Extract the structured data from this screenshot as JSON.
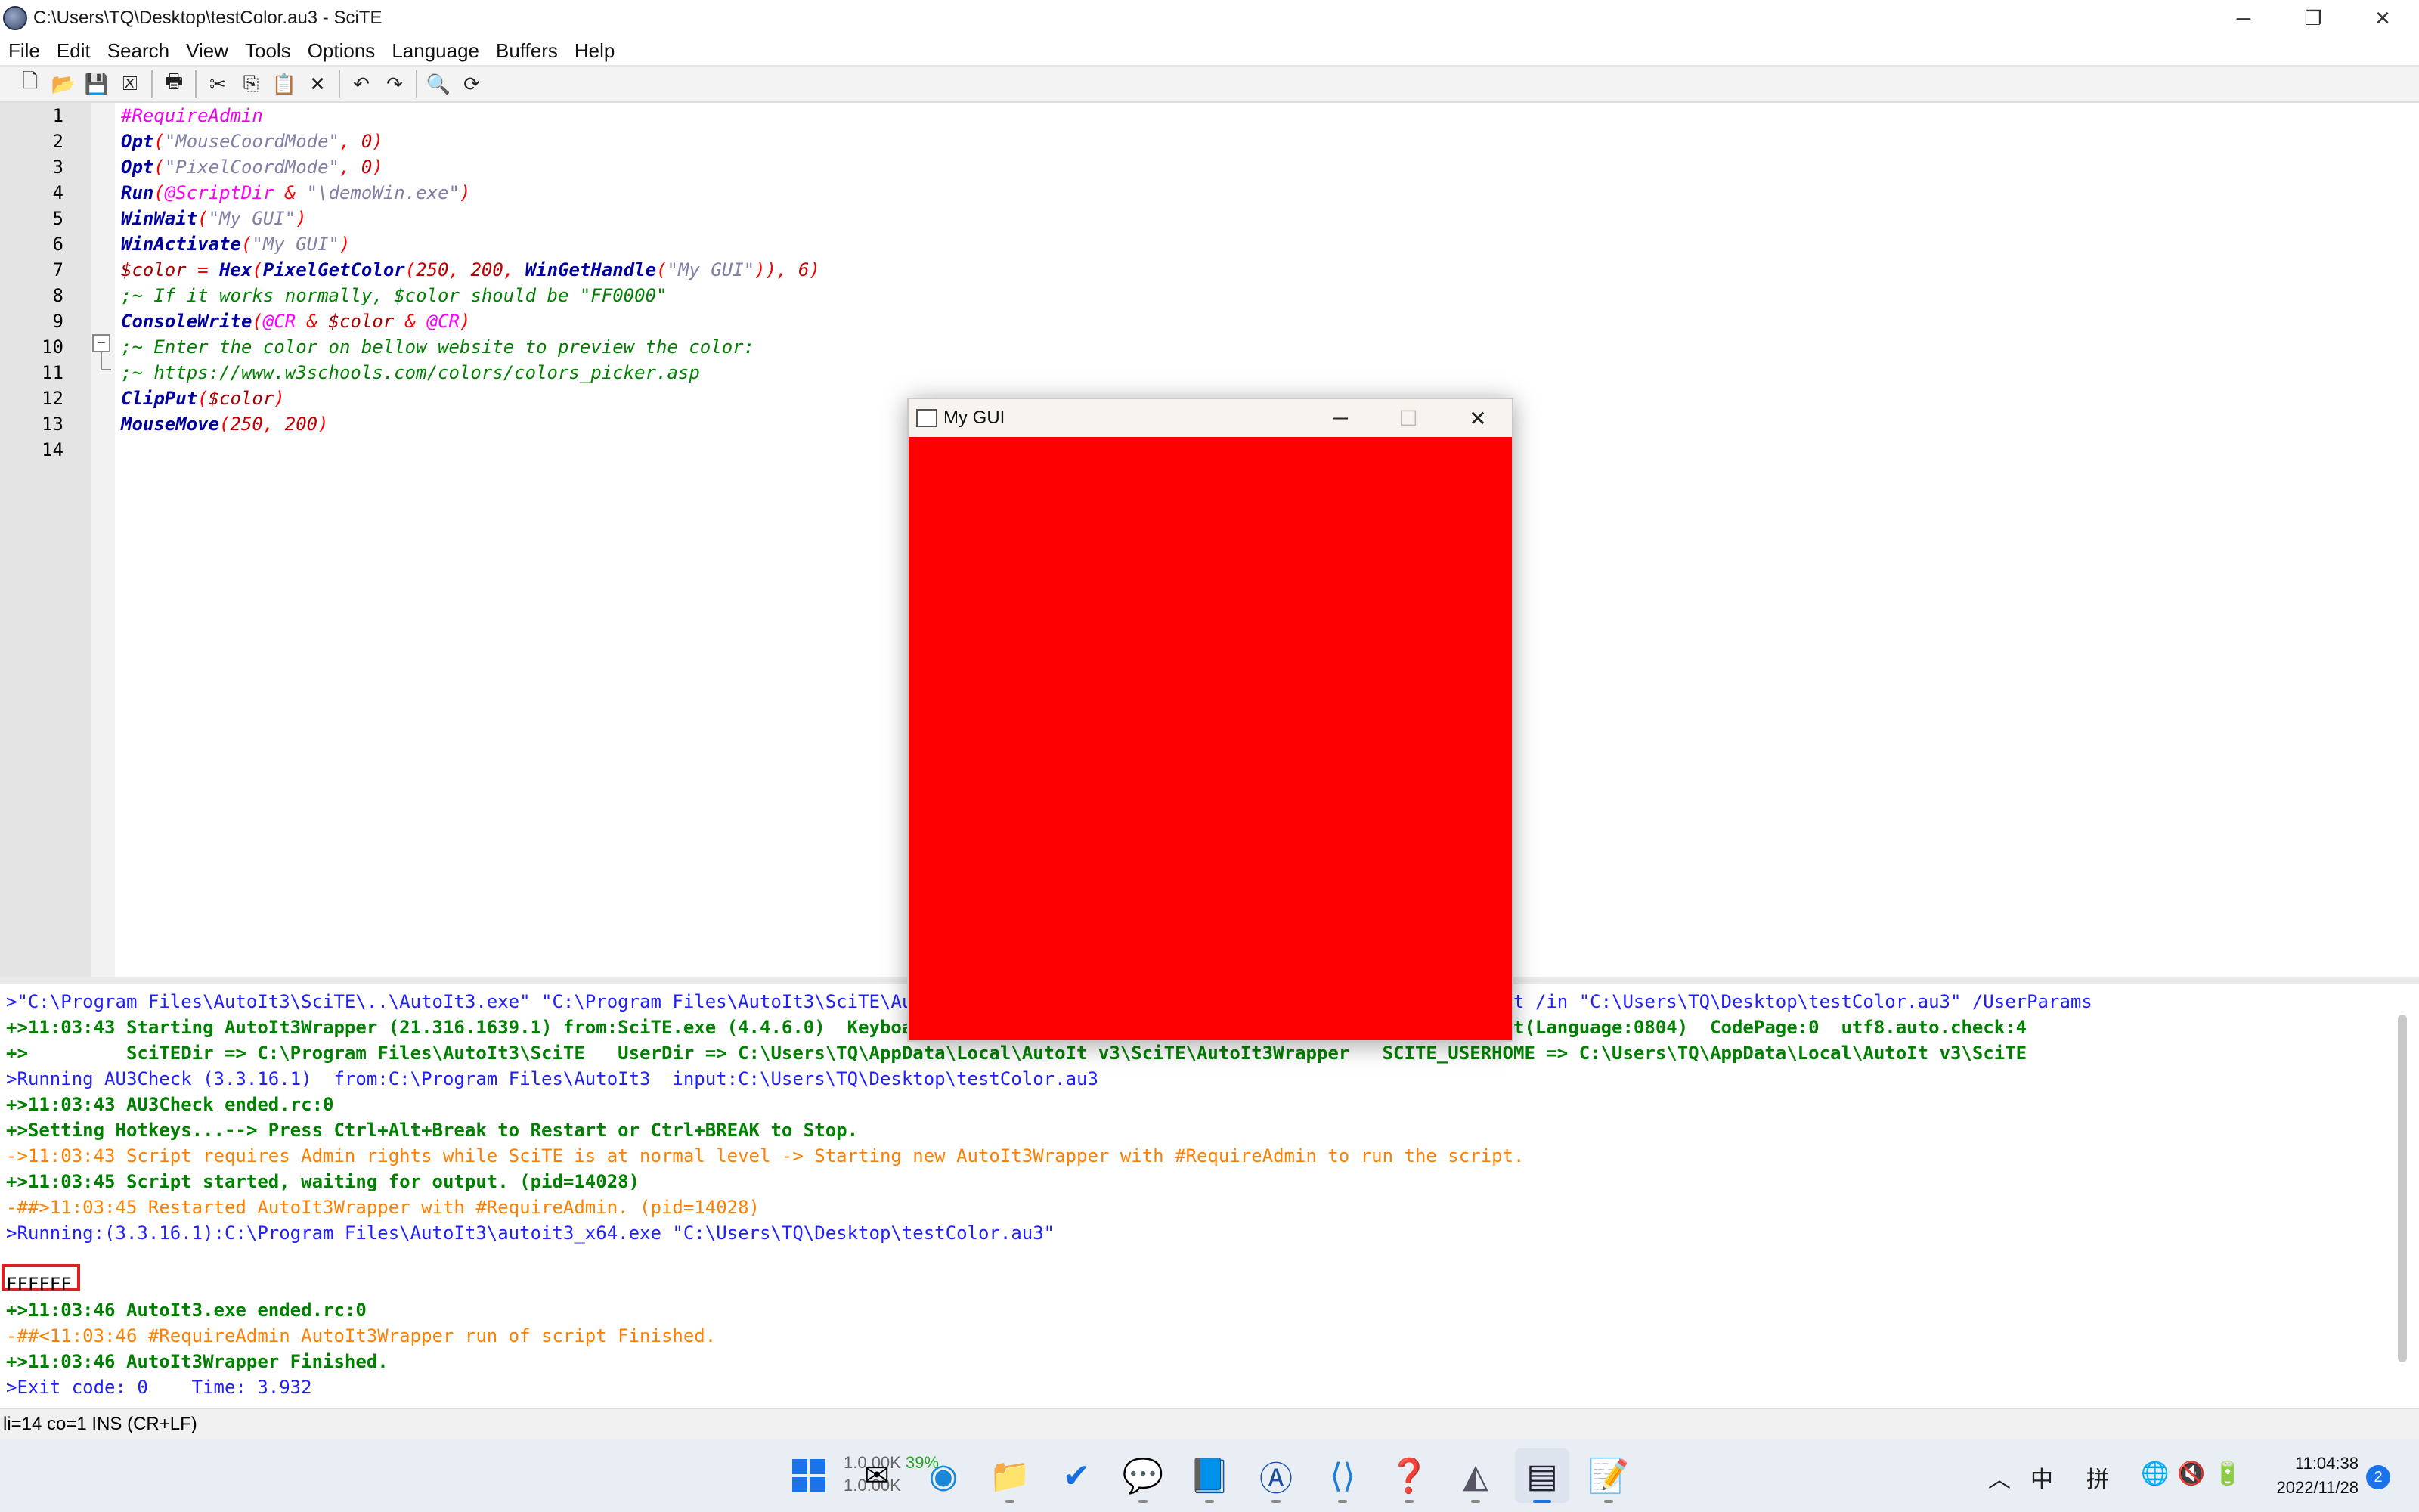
{
  "window": {
    "title": "C:\\Users\\TQ\\Desktop\\testColor.au3 - SciTE",
    "minimize_glyph": "─",
    "restore_glyph": "❐",
    "close_glyph": "✕"
  },
  "menu": [
    "File",
    "Edit",
    "Search",
    "View",
    "Tools",
    "Options",
    "Language",
    "Buffers",
    "Help"
  ],
  "toolbar": {
    "icons": [
      "new-file-icon",
      "open-folder-icon",
      "save-icon",
      "close-file-icon",
      "print-icon",
      "cut-icon",
      "copy-icon",
      "paste-icon",
      "delete-icon",
      "undo-icon",
      "redo-icon",
      "find-icon",
      "replace-icon"
    ],
    "glyphs": {
      "new": "🗋",
      "open": "📂",
      "save": "💾",
      "close": "🗵",
      "print": "🖶",
      "cut": "✂",
      "copy": "⎘",
      "paste": "📋",
      "delete": "✕",
      "undo": "↶",
      "redo": "↷",
      "find": "🔍",
      "replace": "⟳"
    }
  },
  "editor": {
    "line_numbers": [
      "1",
      "2",
      "3",
      "4",
      "5",
      "6",
      "7",
      "8",
      "9",
      "10",
      "11",
      "12",
      "13",
      "14"
    ],
    "lines": [
      [
        {
          "t": "#RequireAdmin",
          "c": "d"
        }
      ],
      [
        {
          "t": "Opt",
          "c": "k"
        },
        {
          "t": "(",
          "c": "p"
        },
        {
          "t": "\"MouseCoordMode\"",
          "c": "s"
        },
        {
          "t": ", ",
          "c": "p"
        },
        {
          "t": "0",
          "c": "n"
        },
        {
          "t": ")",
          "c": "p"
        }
      ],
      [
        {
          "t": "Opt",
          "c": "k"
        },
        {
          "t": "(",
          "c": "p"
        },
        {
          "t": "\"PixelCoordMode\"",
          "c": "s"
        },
        {
          "t": ", ",
          "c": "p"
        },
        {
          "t": "0",
          "c": "n"
        },
        {
          "t": ")",
          "c": "p"
        }
      ],
      [
        {
          "t": "Run",
          "c": "k"
        },
        {
          "t": "(",
          "c": "p"
        },
        {
          "t": "@ScriptDir",
          "c": "m"
        },
        {
          "t": " & ",
          "c": "p"
        },
        {
          "t": "\"\\demoWin.exe\"",
          "c": "s"
        },
        {
          "t": ")",
          "c": "p"
        }
      ],
      [
        {
          "t": "WinWait",
          "c": "k"
        },
        {
          "t": "(",
          "c": "p"
        },
        {
          "t": "\"My GUI\"",
          "c": "s"
        },
        {
          "t": ")",
          "c": "p"
        }
      ],
      [
        {
          "t": "WinActivate",
          "c": "k"
        },
        {
          "t": "(",
          "c": "p"
        },
        {
          "t": "\"My GUI\"",
          "c": "s"
        },
        {
          "t": ")",
          "c": "p"
        }
      ],
      [
        {
          "t": "$color",
          "c": "v"
        },
        {
          "t": " = ",
          "c": "p"
        },
        {
          "t": "Hex",
          "c": "k"
        },
        {
          "t": "(",
          "c": "p"
        },
        {
          "t": "PixelGetColor",
          "c": "k"
        },
        {
          "t": "(",
          "c": "p"
        },
        {
          "t": "250",
          "c": "n"
        },
        {
          "t": ", ",
          "c": "p"
        },
        {
          "t": "200",
          "c": "n"
        },
        {
          "t": ", ",
          "c": "p"
        },
        {
          "t": "WinGetHandle",
          "c": "k"
        },
        {
          "t": "(",
          "c": "p"
        },
        {
          "t": "\"My GUI\"",
          "c": "s"
        },
        {
          "t": ")), ",
          "c": "p"
        },
        {
          "t": "6",
          "c": "n"
        },
        {
          "t": ")",
          "c": "p"
        }
      ],
      [
        {
          "t": ";~ If it works normally, $color should be \"FF0000\"",
          "c": "c"
        }
      ],
      [
        {
          "t": "ConsoleWrite",
          "c": "k"
        },
        {
          "t": "(",
          "c": "p"
        },
        {
          "t": "@CR",
          "c": "m"
        },
        {
          "t": " & ",
          "c": "p"
        },
        {
          "t": "$color",
          "c": "v"
        },
        {
          "t": " & ",
          "c": "p"
        },
        {
          "t": "@CR",
          "c": "m"
        },
        {
          "t": ")",
          "c": "p"
        }
      ],
      [
        {
          "t": ";~ Enter the color on bellow website to preview the color:",
          "c": "c"
        }
      ],
      [
        {
          "t": ";~ https://www.w3schools.com/colors/colors_picker.asp",
          "c": "c"
        }
      ],
      [
        {
          "t": "ClipPut",
          "c": "k"
        },
        {
          "t": "(",
          "c": "p"
        },
        {
          "t": "$color",
          "c": "v"
        },
        {
          "t": ")",
          "c": "p"
        }
      ],
      [
        {
          "t": "MouseMove",
          "c": "k"
        },
        {
          "t": "(",
          "c": "p"
        },
        {
          "t": "250",
          "c": "n"
        },
        {
          "t": ", ",
          "c": "p"
        },
        {
          "t": "200",
          "c": "n"
        },
        {
          "t": ")",
          "c": "p"
        }
      ],
      []
    ],
    "fold_minus": "−"
  },
  "output": {
    "lines": [
      {
        "t": ">\"C:\\Program Files\\AutoIt3\\SciTE\\..\\AutoIt3.exe\" \"C:\\Program Files\\AutoIt3\\SciTE\\AutoIt3Wrapper\\AutoIt3Wrapper.au3\" /run /prod /ErrorStdOut /in \"C:\\Users\\TQ\\Desktop\\testColor.au3\" /UserParams",
        "c": "blue"
      },
      {
        "t": "+>11:03:43 Starting AutoIt3Wrapper (21.316.1639.1) from:SciTE.exe (4.4.6.0)  Keyboard:00000804  OS:WIN_10/2009  CPU:X64 OS:X64  Environment(Language:0804)  CodePage:0  utf8.auto.check:4",
        "c": "green"
      },
      {
        "t": "+>         SciTEDir => C:\\Program Files\\AutoIt3\\SciTE   UserDir => C:\\Users\\TQ\\AppData\\Local\\AutoIt v3\\SciTE\\AutoIt3Wrapper   SCITE_USERHOME => C:\\Users\\TQ\\AppData\\Local\\AutoIt v3\\SciTE",
        "c": "green"
      },
      {
        "t": ">Running AU3Check (3.3.16.1)  from:C:\\Program Files\\AutoIt3  input:C:\\Users\\TQ\\Desktop\\testColor.au3",
        "c": "blue"
      },
      {
        "t": "+>11:03:43 AU3Check ended.rc:0",
        "c": "green"
      },
      {
        "t": "+>Setting Hotkeys...--> Press Ctrl+Alt+Break to Restart or Ctrl+BREAK to Stop.",
        "c": "green"
      },
      {
        "t": "->11:03:43 Script requires Admin rights while SciTE is at normal level -> Starting new AutoIt3Wrapper with #RequireAdmin to run the script.",
        "c": "orange"
      },
      {
        "t": "+>11:03:45 Script started, waiting for output. (pid=14028)",
        "c": "green"
      },
      {
        "t": "-##>11:03:45 Restarted AutoIt3Wrapper with #RequireAdmin. (pid=14028)",
        "c": "orange"
      },
      {
        "t": ">Running:(3.3.16.1):C:\\Program Files\\AutoIt3\\autoit3_x64.exe \"C:\\Users\\TQ\\Desktop\\testColor.au3\"",
        "c": "blue"
      },
      {
        "t": "",
        "c": "black"
      },
      {
        "t": "FFFFFF",
        "c": "black"
      },
      {
        "t": "+>11:03:46 AutoIt3.exe ended.rc:0",
        "c": "green"
      },
      {
        "t": "-##<11:03:46 #RequireAdmin AutoIt3Wrapper run of script Finished.",
        "c": "orange"
      },
      {
        "t": "+>11:03:46 AutoIt3Wrapper Finished.",
        "c": "green"
      },
      {
        "t": ">Exit code: 0    Time: 3.932",
        "c": "blue"
      }
    ]
  },
  "statusbar": {
    "text": "li=14 co=1 INS (CR+LF)"
  },
  "gui_window": {
    "title": "My GUI",
    "fill_color": "#ff0000",
    "minimize_glyph": "─",
    "maximize_glyph": "☐",
    "close_glyph": "✕"
  },
  "taskbar": {
    "net_up": "1.0.00K",
    "net_down": "1.0.00K",
    "cpu": "39%",
    "tray_chevron": "︿",
    "ime1": "中",
    "ime2": "拼",
    "net_icon": "🌐",
    "sound_icon": "🔇",
    "battery_icon": "🔋",
    "time": "11:04:38",
    "date": "2022/11/28",
    "notif_count": "2"
  },
  "colors": {
    "accent_red": "#ff0000",
    "highlight_box": "#e02020"
  }
}
